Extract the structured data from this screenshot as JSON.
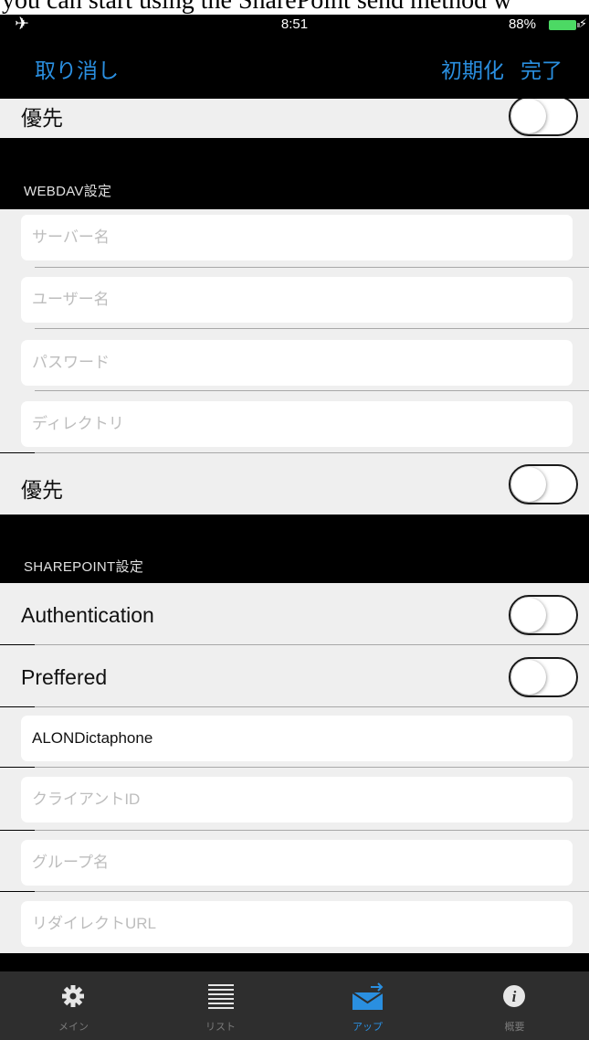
{
  "caption_fragment": "you can start using the SharePoint send method w",
  "status": {
    "time": "8:51",
    "battery": "88%"
  },
  "nav": {
    "cancel": "取り消し",
    "reset": "初期化",
    "done": "完了"
  },
  "top_row": {
    "label": "優先",
    "on": false
  },
  "webdav": {
    "header": "WEBDAV設定",
    "fields": [
      {
        "placeholder": "サーバー名",
        "value": ""
      },
      {
        "placeholder": "ユーザー名",
        "value": ""
      },
      {
        "placeholder": "パスワード",
        "value": ""
      },
      {
        "placeholder": "ディレクトリ",
        "value": ""
      }
    ],
    "priority": {
      "label": "優先",
      "on": false
    }
  },
  "sharepoint": {
    "header": "SHAREPOINT設定",
    "authentication": {
      "label": "Authentication",
      "on": false
    },
    "preferred": {
      "label": "Preffered",
      "on": false
    },
    "fields": [
      {
        "placeholder": "",
        "value": "ALONDictaphone"
      },
      {
        "placeholder": "クライアントID",
        "value": ""
      },
      {
        "placeholder": "グループ名",
        "value": ""
      },
      {
        "placeholder": "リダイレクトURL",
        "value": ""
      }
    ]
  },
  "tabs": [
    {
      "label": "メイン",
      "icon": "gear-icon",
      "active": false
    },
    {
      "label": "リスト",
      "icon": "list-icon",
      "active": false
    },
    {
      "label": "アップ",
      "icon": "upload-mail-icon",
      "active": true
    },
    {
      "label": "概要",
      "icon": "info-icon",
      "active": false
    }
  ],
  "colors": {
    "accent": "#2a8fe0",
    "switch_on": "#4cd964",
    "background": "#efefef"
  }
}
